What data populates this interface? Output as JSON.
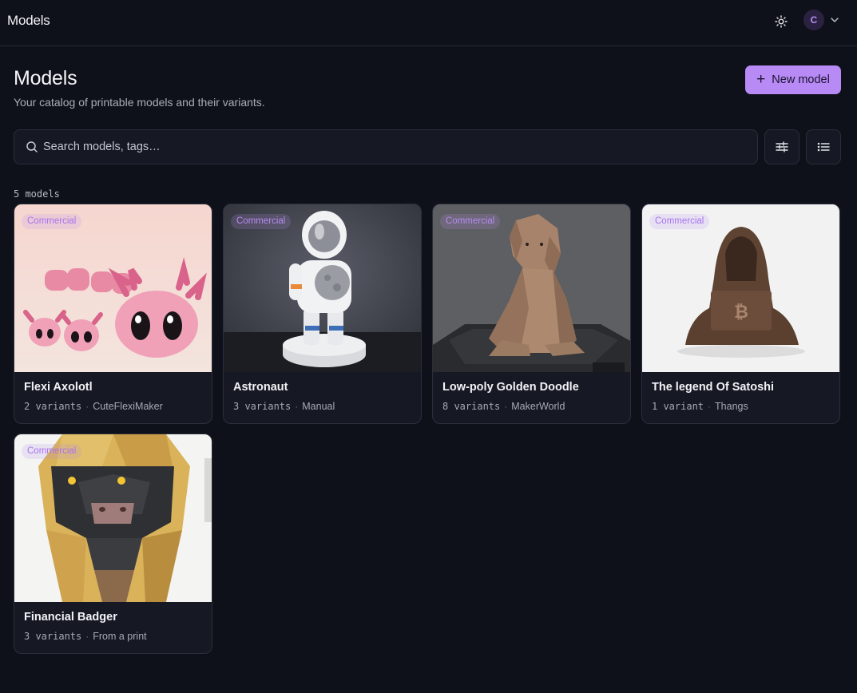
{
  "topbar": {
    "title": "Models",
    "theme_icon": "sun-icon",
    "avatar_initial": "C"
  },
  "header": {
    "title": "Models",
    "subtitle": "Your catalog of printable models and their variants.",
    "new_button_label": "New model"
  },
  "search": {
    "placeholder": "Search models, tags…",
    "value": ""
  },
  "count_label": "5 models",
  "colors": {
    "background": "#0f111a",
    "accent": "#b78af5",
    "card": "#161924"
  },
  "models": [
    {
      "name": "Flexi Axolotl",
      "badge": "Commercial",
      "variants": "2 variants",
      "source": "CuteFlexiMaker"
    },
    {
      "name": "Astronaut",
      "badge": "Commercial",
      "variants": "3 variants",
      "source": "Manual"
    },
    {
      "name": "Low-poly Golden Doodle",
      "badge": "Commercial",
      "variants": "8 variants",
      "source": "MakerWorld"
    },
    {
      "name": "The legend Of Satoshi",
      "badge": "Commercial",
      "variants": "1 variant",
      "source": "Thangs"
    },
    {
      "name": "Financial Badger",
      "badge": "Commercial",
      "variants": "3 variants",
      "source": "From a print"
    }
  ]
}
